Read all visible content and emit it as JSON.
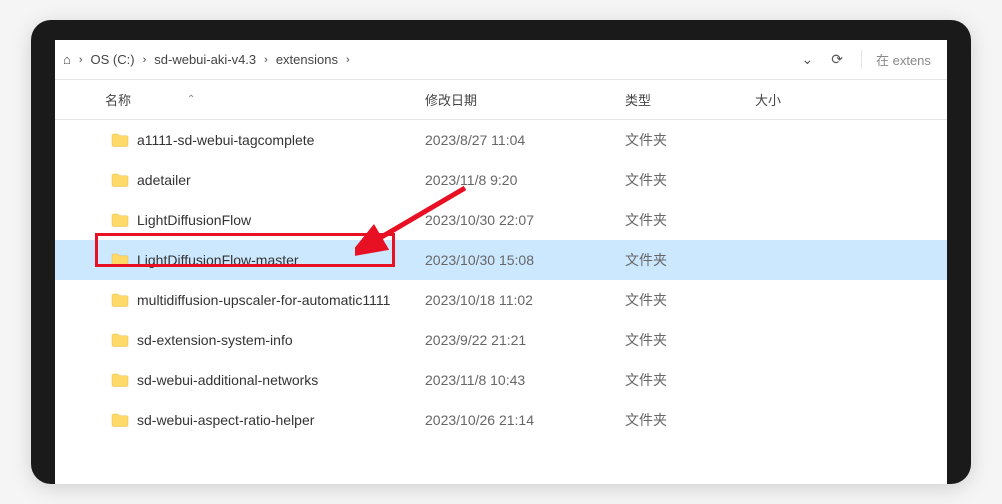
{
  "breadcrumb": {
    "root_fragment": "⌂",
    "sep": "›",
    "parts": [
      "OS (C:)",
      "sd-webui-aki-v4.3",
      "extensions"
    ]
  },
  "toolbar": {
    "dropdown_glyph": "⌄",
    "refresh_glyph": "⟳"
  },
  "search": {
    "placeholder": "在 extens"
  },
  "columns": {
    "name": "名称",
    "date": "修改日期",
    "type": "类型",
    "size": "大小",
    "sort_glyph": "⌃"
  },
  "rows": [
    {
      "name": "a1111-sd-webui-tagcomplete",
      "date": "2023/8/27 11:04",
      "type": "文件夹",
      "selected": false
    },
    {
      "name": "adetailer",
      "date": "2023/11/8 9:20",
      "type": "文件夹",
      "selected": false
    },
    {
      "name": "LightDiffusionFlow",
      "date": "2023/10/30 22:07",
      "type": "文件夹",
      "selected": false
    },
    {
      "name": "LightDiffusionFlow-master",
      "date": "2023/10/30 15:08",
      "type": "文件夹",
      "selected": true
    },
    {
      "name": "multidiffusion-upscaler-for-automatic1111",
      "date": "2023/10/18 11:02",
      "type": "文件夹",
      "selected": false
    },
    {
      "name": "sd-extension-system-info",
      "date": "2023/9/22 21:21",
      "type": "文件夹",
      "selected": false
    },
    {
      "name": "sd-webui-additional-networks",
      "date": "2023/11/8 10:43",
      "type": "文件夹",
      "selected": false
    },
    {
      "name": "sd-webui-aspect-ratio-helper",
      "date": "2023/10/26 21:14",
      "type": "文件夹",
      "selected": false
    }
  ]
}
